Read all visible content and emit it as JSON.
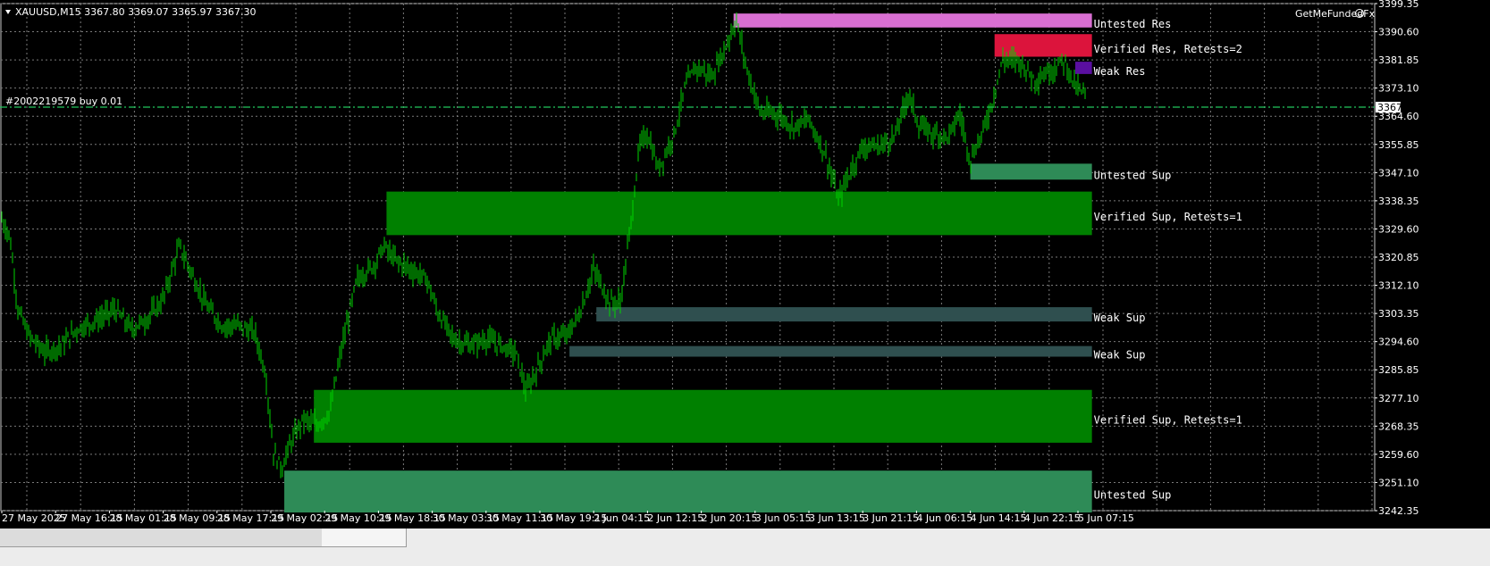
{
  "header": {
    "symbol_line": "XAUUSD,M15  3367.80 3369.07 3365.97 3367.30",
    "brand": "GetMeFundedFx",
    "order_label": "#2002219579 buy 0.01"
  },
  "chart_data": {
    "type": "candlestick",
    "symbol": "XAUUSD",
    "timeframe": "M15",
    "ohlc_last": {
      "open": 3367.8,
      "high": 3369.07,
      "low": 3365.97,
      "close": 3367.3
    },
    "current_price": "3367.30",
    "y_range": [
      3242.35,
      3395.0
    ],
    "y_ticks": [
      "3399.35",
      "3390.60",
      "3381.85",
      "3373.10",
      "3364.60",
      "3355.85",
      "3347.10",
      "3338.35",
      "3329.60",
      "3320.85",
      "3312.10",
      "3303.35",
      "3294.60",
      "3285.85",
      "3277.10",
      "3268.35",
      "3259.60",
      "3251.10",
      "3242.35"
    ],
    "x_ticks": [
      "27 May 2025",
      "27 May 16:15",
      "28 May 01:15",
      "28 May 09:15",
      "28 May 17:15",
      "29 May 02:15",
      "29 May 10:15",
      "29 May 18:15",
      "30 May 03:15",
      "30 May 11:15",
      "30 May 19:15",
      "2 Jun 04:15",
      "2 Jun 12:15",
      "2 Jun 20:15",
      "3 Jun 05:15",
      "3 Jun 13:15",
      "3 Jun 21:15",
      "4 Jun 06:15",
      "4 Jun 14:15",
      "4 Jun 22:15",
      "5 Jun 07:15"
    ],
    "grid": true,
    "zones": [
      {
        "label": "Untested Res",
        "top": 3392.0,
        "bottom": 3387.8,
        "start_index": 13.6,
        "color": "#d96fd2"
      },
      {
        "label": "Verified Res, Retests=2",
        "top": 3385.8,
        "bottom": 3379.0,
        "start_index": 18.45,
        "color": "#dc143c"
      },
      {
        "label": "Weak Res",
        "top": 3377.5,
        "bottom": 3373.8,
        "start_index": 19.95,
        "color": "#5a0fa0"
      },
      {
        "label": "Untested Sup",
        "top": 3346.8,
        "bottom": 3342.0,
        "start_index": 18.0,
        "color": "#2e8b57"
      },
      {
        "label": "Verified Sup, Retests=1",
        "top": 3338.4,
        "bottom": 3325.3,
        "start_index": 7.15,
        "color": "#008000"
      },
      {
        "label": "Weak Sup",
        "top": 3303.6,
        "bottom": 3299.3,
        "start_index": 11.05,
        "color": "#2f4f4f"
      },
      {
        "label": "Weak Sup",
        "top": 3291.9,
        "bottom": 3288.7,
        "start_index": 10.55,
        "color": "#2f4f4f"
      },
      {
        "label": "Verified Sup, Retests=1",
        "top": 3278.7,
        "bottom": 3262.8,
        "start_index": 5.8,
        "color": "#008000"
      },
      {
        "label": "Untested Sup",
        "top": 3254.4,
        "bottom": 3241.8,
        "start_index": 5.25,
        "color": "#2e8b57"
      }
    ],
    "price_path": [
      [
        0,
        3330
      ],
      [
        0.15,
        3325
      ],
      [
        0.3,
        3303
      ],
      [
        0.5,
        3295
      ],
      [
        0.8,
        3290
      ],
      [
        1.1,
        3292
      ],
      [
        1.4,
        3297
      ],
      [
        1.8,
        3300
      ],
      [
        2.1,
        3303
      ],
      [
        2.4,
        3297
      ],
      [
        2.7,
        3300
      ],
      [
        3.0,
        3306
      ],
      [
        3.3,
        3322
      ],
      [
        3.5,
        3315
      ],
      [
        3.8,
        3304
      ],
      [
        4.1,
        3298
      ],
      [
        4.4,
        3298
      ],
      [
        4.7,
        3296
      ],
      [
        4.9,
        3284
      ],
      [
        5.05,
        3260
      ],
      [
        5.2,
        3255
      ],
      [
        5.35,
        3262
      ],
      [
        5.6,
        3270
      ],
      [
        5.85,
        3268
      ],
      [
        6.1,
        3272
      ],
      [
        6.3,
        3290
      ],
      [
        6.6,
        3312
      ],
      [
        6.9,
        3316
      ],
      [
        7.1,
        3322
      ],
      [
        7.3,
        3318
      ],
      [
        7.6,
        3315
      ],
      [
        7.9,
        3312
      ],
      [
        8.1,
        3302
      ],
      [
        8.4,
        3294
      ],
      [
        8.7,
        3292
      ],
      [
        9.0,
        3294
      ],
      [
        9.3,
        3292
      ],
      [
        9.55,
        3290
      ],
      [
        9.75,
        3278
      ],
      [
        9.95,
        3285
      ],
      [
        10.2,
        3294
      ],
      [
        10.5,
        3295
      ],
      [
        10.75,
        3302
      ],
      [
        11.0,
        3315
      ],
      [
        11.3,
        3305
      ],
      [
        11.5,
        3305
      ],
      [
        11.7,
        3330
      ],
      [
        11.85,
        3352
      ],
      [
        12.0,
        3356
      ],
      [
        12.2,
        3345
      ],
      [
        12.5,
        3356
      ],
      [
        12.7,
        3370
      ],
      [
        12.9,
        3376
      ],
      [
        13.2,
        3373
      ],
      [
        13.45,
        3382
      ],
      [
        13.65,
        3390
      ],
      [
        13.85,
        3375
      ],
      [
        14.1,
        3362
      ],
      [
        14.4,
        3362
      ],
      [
        14.7,
        3358
      ],
      [
        15.0,
        3360
      ],
      [
        15.3,
        3350
      ],
      [
        15.55,
        3336
      ],
      [
        15.7,
        3342
      ],
      [
        16.0,
        3352
      ],
      [
        16.3,
        3352
      ],
      [
        16.6,
        3355
      ],
      [
        16.85,
        3368
      ],
      [
        17.05,
        3358
      ],
      [
        17.3,
        3356
      ],
      [
        17.6,
        3355
      ],
      [
        17.8,
        3362
      ],
      [
        18.0,
        3348
      ],
      [
        18.2,
        3355
      ],
      [
        18.4,
        3365
      ],
      [
        18.6,
        3378
      ],
      [
        18.9,
        3378
      ],
      [
        19.2,
        3372
      ],
      [
        19.5,
        3375
      ],
      [
        19.75,
        3378
      ],
      [
        19.95,
        3370
      ],
      [
        20.15,
        3367.3
      ]
    ]
  },
  "tabs": [
    "",
    "",
    "",
    "",
    ""
  ]
}
